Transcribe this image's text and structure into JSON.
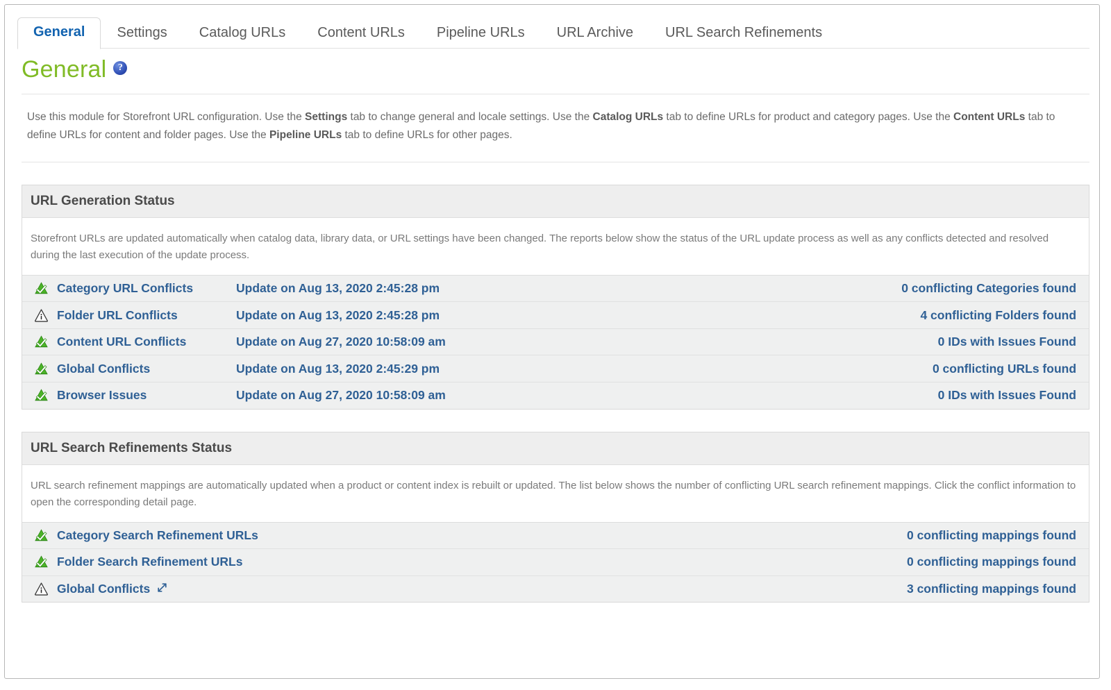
{
  "tabs": [
    {
      "label": "General",
      "active": true
    },
    {
      "label": "Settings",
      "active": false
    },
    {
      "label": "Catalog URLs",
      "active": false
    },
    {
      "label": "Content URLs",
      "active": false
    },
    {
      "label": "Pipeline URLs",
      "active": false
    },
    {
      "label": "URL Archive",
      "active": false
    },
    {
      "label": "URL Search Refinements",
      "active": false
    }
  ],
  "page": {
    "title": "General",
    "help_icon_glyph": "?",
    "title_color": "#80bb26"
  },
  "intro": {
    "part1": "Use this module for Storefront URL configuration. Use the ",
    "bold1": "Settings",
    "part2": " tab to change general and locale settings. Use the ",
    "bold2": "Catalog URLs",
    "part3": " tab to define URLs for product and category pages. Use the ",
    "bold3": "Content URLs",
    "part4": " tab to define URLs for content and folder pages. Use the ",
    "bold4": "Pipeline URLs",
    "part5": " tab to define URLs for other pages."
  },
  "url_generation_status": {
    "header": "URL Generation Status",
    "description": "Storefront URLs are updated automatically when catalog data, library data, or URL settings have been changed. The reports below show the status of the URL update process as well as any conflicts detected and resolved during the last execution of the update process.",
    "rows": [
      {
        "icon": "status-ok-icon",
        "name": "Category URL Conflicts",
        "date": "Update on Aug 13, 2020 2:45:28 pm",
        "count": "0 conflicting Categories found"
      },
      {
        "icon": "status-warning-icon",
        "name": "Folder URL Conflicts",
        "date": "Update on Aug 13, 2020 2:45:28 pm",
        "count": "4 conflicting Folders found"
      },
      {
        "icon": "status-ok-icon",
        "name": "Content URL Conflicts",
        "date": "Update on Aug 27, 2020 10:58:09 am",
        "count": "0 IDs with Issues Found"
      },
      {
        "icon": "status-ok-icon",
        "name": "Global Conflicts",
        "date": "Update on Aug 13, 2020 2:45:29 pm",
        "count": "0 conflicting URLs found"
      },
      {
        "icon": "status-ok-icon",
        "name": "Browser Issues",
        "date": "Update on Aug 27, 2020 10:58:09 am",
        "count": "0 IDs with Issues Found"
      }
    ]
  },
  "url_search_refinements_status": {
    "header": "URL Search Refinements Status",
    "description": "URL search refinement mappings are automatically updated when a product or content index is rebuilt or updated. The list below shows the number of conflicting URL search refinement mappings. Click the conflict information to open the corresponding detail page.",
    "rows": [
      {
        "icon": "status-ok-icon",
        "name": "Category Search Refinement URLs",
        "count": "0 conflicting mappings found",
        "expand": false
      },
      {
        "icon": "status-ok-icon",
        "name": "Folder Search Refinement URLs",
        "count": "0 conflicting mappings found",
        "expand": false
      },
      {
        "icon": "status-warning-icon",
        "name": "Global Conflicts",
        "count": "3 conflicting mappings found",
        "expand": true,
        "expand_icon": "expand-diagonal-icon"
      }
    ]
  },
  "colors": {
    "active_tab": "#1263b0",
    "title_green": "#80bb26",
    "link_blue": "#2f6095",
    "ok_green": "#3d9b20",
    "row_bg": "#eff0f0",
    "panel_header_bg": "#eeeeee"
  }
}
